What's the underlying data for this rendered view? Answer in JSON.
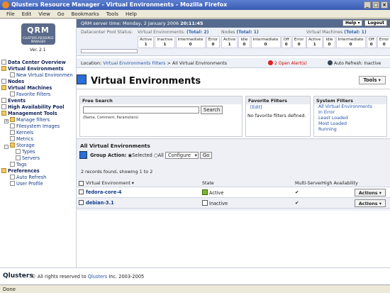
{
  "window": {
    "title": "Qlusters Resource Manager - Virtual Environments - Mozilla Firefox"
  },
  "menu": [
    "File",
    "Edit",
    "View",
    "Go",
    "Bookmarks",
    "Tools",
    "Help"
  ],
  "logo": {
    "text": "QRM",
    "sub": "CLUSTERS RESOURCE MANAGER",
    "version": "Ver. 2.1"
  },
  "sidebar": [
    {
      "label": "Data Center Overview",
      "bold": true,
      "icon": "page"
    },
    {
      "label": "Virtual Environments",
      "bold": true,
      "icon": "folder-open"
    },
    {
      "label": "New Virtual Environmen",
      "bold": false,
      "icon": "page"
    },
    {
      "label": "Nodes",
      "bold": true,
      "icon": "page"
    },
    {
      "label": "Virtual Machines",
      "bold": true,
      "icon": "folder"
    },
    {
      "label": "Favorite Filters",
      "bold": false,
      "icon": "page"
    },
    {
      "label": "Events",
      "bold": true,
      "icon": "page"
    },
    {
      "label": "High Availability Pool",
      "bold": true,
      "icon": "page"
    },
    {
      "label": "Management Tools",
      "bold": true,
      "icon": "folder"
    },
    {
      "label": "Manage filters",
      "bold": false,
      "icon": "folder"
    },
    {
      "label": "Filesystem Images",
      "bold": false,
      "icon": "page"
    },
    {
      "label": "Kernels",
      "bold": false,
      "icon": "page"
    },
    {
      "label": "Metrics",
      "bold": false,
      "icon": "page"
    },
    {
      "label": "Storage",
      "bold": false,
      "icon": "folder"
    },
    {
      "label": "Types",
      "bold": false,
      "icon": "page"
    },
    {
      "label": "Servers",
      "bold": false,
      "icon": "page"
    },
    {
      "label": "Tags",
      "bold": false,
      "icon": "page"
    },
    {
      "label": "Preferences",
      "bold": true,
      "icon": "folder"
    },
    {
      "label": "Auto Refresh",
      "bold": false,
      "icon": "page"
    },
    {
      "label": "User Profile",
      "bold": false,
      "icon": "page"
    }
  ],
  "topbar": {
    "server_label": "QRM server time:",
    "server_time": "Monday, 2 January 2006",
    "server_clock": "20:11:45",
    "help": "Help ▾",
    "logout": "Logout"
  },
  "stats": {
    "pool": {
      "label": "Datacenter Pool Status:"
    },
    "ve": {
      "label": "Virtual Environments:",
      "total": "(Total: 2)",
      "cells": [
        [
          "Active",
          "1"
        ],
        [
          "Inactive",
          "1"
        ],
        [
          "Intermediate",
          "0"
        ],
        [
          "Error",
          "0"
        ]
      ]
    },
    "nodes": {
      "label": "Nodes",
      "total": "(Total: 1)",
      "cells": [
        [
          "Active",
          "1"
        ],
        [
          "Idle",
          "0"
        ],
        [
          "Intermediate",
          "0"
        ],
        [
          "Off",
          "0"
        ],
        [
          "Error",
          "0"
        ]
      ]
    },
    "vm": {
      "label": "Virtual Machines",
      "total": "(Total: 1)",
      "cells": [
        [
          "Active",
          "1"
        ],
        [
          "Idle",
          "0"
        ],
        [
          "Intermediate",
          "0"
        ],
        [
          "Off",
          "0"
        ],
        [
          "Error",
          "0"
        ]
      ]
    }
  },
  "location": {
    "prefix": "Location:",
    "link": "Virtual Environments Filters",
    "current": "> All Virtual Environments",
    "alerts": "2 Open Alert(s)",
    "autorefresh": "Auto Refresh: Inactive"
  },
  "page": {
    "title": "Virtual Environments",
    "tools": "Tools ▾"
  },
  "free_search": {
    "title": "Free Search",
    "button": "Search",
    "hint": "(Name, Comment, Parameters)",
    "value": ""
  },
  "favorite": {
    "title": "Favorite Filters",
    "edit": "[Edit]",
    "empty": "No favorite filters defined."
  },
  "system_filters": {
    "title": "System Filters",
    "items": [
      "All Virtual Environments",
      "In Error",
      "Least Loaded",
      "Most Loaded",
      "Running"
    ]
  },
  "ve_section": {
    "title": "All Virtual Environments",
    "group_action": "Group Action:",
    "selected": "Selected",
    "all": "All",
    "configure": "Configure",
    "go": "Go",
    "records": "2 records found, showing 1 to 2"
  },
  "table": {
    "headers": [
      "Virtual Environment ▾",
      "State",
      "Multi-Server",
      "High Availability"
    ],
    "rows": [
      {
        "name": "fedora-core-4",
        "state": "Active",
        "multi": "✔",
        "ha": "",
        "action": "Actions ▾"
      },
      {
        "name": "debian-3.1",
        "state": "Inactive",
        "multi": "✔",
        "ha": "",
        "action": "Actions ▾"
      }
    ]
  },
  "footer": {
    "logo": "Qlusters",
    "prefix": "© All rights reserved to",
    "company": "Qlusters",
    "suffix": "Inc. 2003-2005"
  },
  "status": {
    "text": "Done"
  },
  "colors": {
    "accent": "#566a8e",
    "active": "#7cb82f",
    "link": "#2255aa"
  }
}
